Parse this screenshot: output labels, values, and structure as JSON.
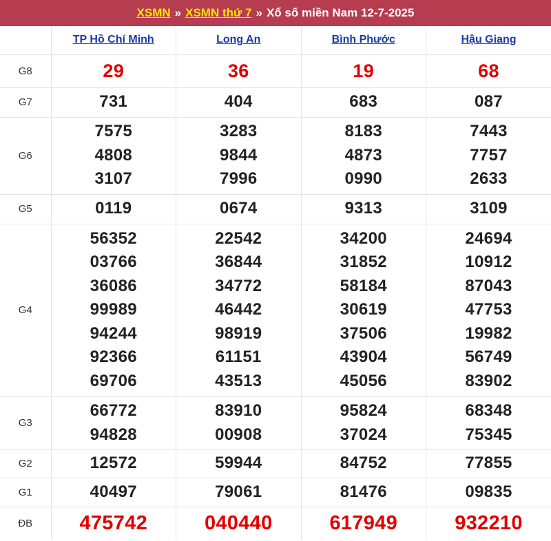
{
  "header": {
    "link1": "XSMN",
    "separator": "»",
    "link2": "XSMN thứ 7",
    "title": "Xổ số miền Nam 12-7-2025"
  },
  "provinces": [
    "TP Hồ Chí Minh",
    "Long An",
    "Bình Phước",
    "Hậu Giang"
  ],
  "prizes": [
    {
      "label": "G8",
      "results": [
        [
          "29"
        ],
        [
          "36"
        ],
        [
          "19"
        ],
        [
          "68"
        ]
      ]
    },
    {
      "label": "G7",
      "results": [
        [
          "731"
        ],
        [
          "404"
        ],
        [
          "683"
        ],
        [
          "087"
        ]
      ]
    },
    {
      "label": "G6",
      "results": [
        [
          "7575",
          "4808",
          "3107"
        ],
        [
          "3283",
          "9844",
          "7996"
        ],
        [
          "8183",
          "4873",
          "0990"
        ],
        [
          "7443",
          "7757",
          "2633"
        ]
      ]
    },
    {
      "label": "G5",
      "results": [
        [
          "0119"
        ],
        [
          "0674"
        ],
        [
          "9313"
        ],
        [
          "3109"
        ]
      ]
    },
    {
      "label": "G4",
      "results": [
        [
          "56352",
          "03766",
          "36086",
          "99989",
          "94244",
          "92366",
          "69706"
        ],
        [
          "22542",
          "36844",
          "34772",
          "46442",
          "98919",
          "61151",
          "43513"
        ],
        [
          "34200",
          "31852",
          "58184",
          "30619",
          "37506",
          "43904",
          "45056"
        ],
        [
          "24694",
          "10912",
          "87043",
          "47753",
          "19982",
          "56749",
          "83902"
        ]
      ]
    },
    {
      "label": "G3",
      "results": [
        [
          "66772",
          "94828"
        ],
        [
          "83910",
          "00908"
        ],
        [
          "95824",
          "37024"
        ],
        [
          "68348",
          "75345"
        ]
      ]
    },
    {
      "label": "G2",
      "results": [
        [
          "12572"
        ],
        [
          "59944"
        ],
        [
          "84752"
        ],
        [
          "77855"
        ]
      ]
    },
    {
      "label": "G1",
      "results": [
        [
          "40497"
        ],
        [
          "79061"
        ],
        [
          "81476"
        ],
        [
          "09835"
        ]
      ]
    },
    {
      "label": "ĐB",
      "results": [
        [
          "475742"
        ],
        [
          "040440"
        ],
        [
          "617949"
        ],
        [
          "932210"
        ]
      ]
    }
  ],
  "colors": {
    "header_bg": "#b63c4f",
    "header_link": "#ffe400",
    "special_red": "#e10000",
    "province_link": "#1a3aa8"
  }
}
